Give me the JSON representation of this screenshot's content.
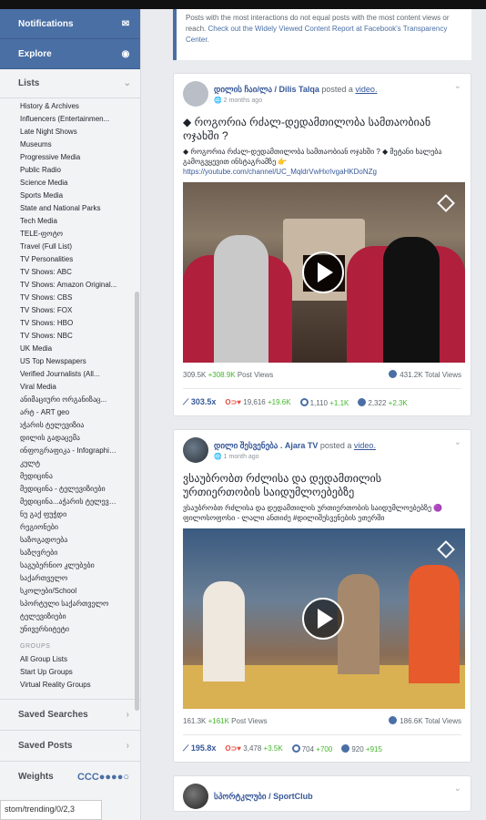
{
  "sidebar": {
    "nav": [
      {
        "label": "Notifications",
        "icon": "envelope-icon"
      },
      {
        "label": "Explore",
        "icon": "compass-icon"
      }
    ],
    "lists_label": "Lists",
    "lists": [
      "History & Archives",
      "Influencers (Entertainmen...",
      "Late Night Shows",
      "Museums",
      "Progressive Media",
      "Public Radio",
      "Science Media",
      "Sports Media",
      "State and National Parks",
      "Tech Media",
      "TELE-ფოტო",
      "Travel (Full List)",
      "TV Personalities",
      "TV Shows: ABC",
      "TV Shows: Amazon Original...",
      "TV Shows: CBS",
      "TV Shows: FOX",
      "TV Shows: HBO",
      "TV Shows: NBC",
      "UK Media",
      "US Top Newspapers",
      "Verified Journalists (All...",
      "Viral Media",
      "ანიმაციური ორგანიზაც...",
      "არტ - ART geo",
      "აჭარის ტელევიზია",
      "დილის გადაცემა",
      "ინფოგრაფიკა - Infographic...",
      "კულტ",
      "მედიცინა",
      "მედიცინა - ტელევიზიები",
      "მედიცინა...აჭარის ტელევიზ...",
      "ნუ გაქ ფუჭდი",
      "რეგიონები",
      "საზოგადოება",
      "საზღვრები",
      "საგუბერნიო კლუბები",
      "საქართველო",
      "სკოლები/School",
      "სპორტული საქართველო",
      "ტელევიზიები",
      "უნივერსიტეტი"
    ],
    "active_index": 25,
    "groups_label": "GROUPS",
    "groups": [
      "All Group Lists",
      "Start Up Groups",
      "Virtual Reality Groups"
    ],
    "saved_searches": "Saved Searches",
    "saved_posts": "Saved Posts",
    "weights": "Weights",
    "weights_icons": "CCC●●●●○",
    "url_text": "stom/trending/0/2,3"
  },
  "notice": {
    "text": "Posts with the most interactions do not equal posts with the most content views or reach. ",
    "link": "Check out the Widely Viewed Content Report at Facebook's Transparency Center."
  },
  "posts": [
    {
      "author": "დილის ჩაი/ლა / Dilis Talqa",
      "posted": " posted a ",
      "video_word": "video.",
      "time": "2 months ago",
      "title": "◆ როგორია რძალ-დედამთილობა სამთაობიან ოჯახში ?",
      "desc": "◆ როგორია რძალ-დედამთილობა სამთაობიან ოჯახში ? ◆ მეტანი ხალება გამოგვყევით ინსტაგრამზე 👉",
      "link": "https://youtube.com/channel/UC_MqldrVwHxrlvgaHKDoNZg",
      "post_views": "309.5K",
      "post_views_delta": "+308.9K",
      "post_views_label": " Post Views",
      "total_views": "431.2K",
      "total_views_label": " Total Views",
      "ratio": "303.5x",
      "reactions": "19,616",
      "reactions_delta": "+19.6K",
      "comments": "1,110",
      "comments_delta": "+1.1K",
      "shares": "2,322",
      "shares_delta": "+2.3K"
    },
    {
      "author": "დილი შესვენება . Ajara TV",
      "posted": " posted a ",
      "video_word": "video.",
      "time": "1 month ago",
      "title": "ვსაუბრობთ რძლისა და დედამთილის ურთიერთობის საიდუმლოებებზე",
      "desc": "ვსაუბრობთ რძლისა და დედამთილის ურთიერთობის საიდუმლოებებზე 🟣 ფილოსოფოსი - ლალი ანთიძე #დილიშესვენების ეთერში",
      "link": "",
      "post_views": "161.3K",
      "post_views_delta": "+161K",
      "post_views_label": " Post Views",
      "total_views": "186.6K",
      "total_views_label": " Total Views",
      "ratio": "195.8x",
      "reactions": "3,478",
      "reactions_delta": "+3.5K",
      "comments": "704",
      "comments_delta": "+700",
      "shares": "920",
      "shares_delta": "+915"
    },
    {
      "author": "სპორტკლუბი / SportClub"
    }
  ],
  "colors": {
    "sidebar_active": "#4a6fa5",
    "link": "#365899",
    "positive": "#42b72a"
  }
}
